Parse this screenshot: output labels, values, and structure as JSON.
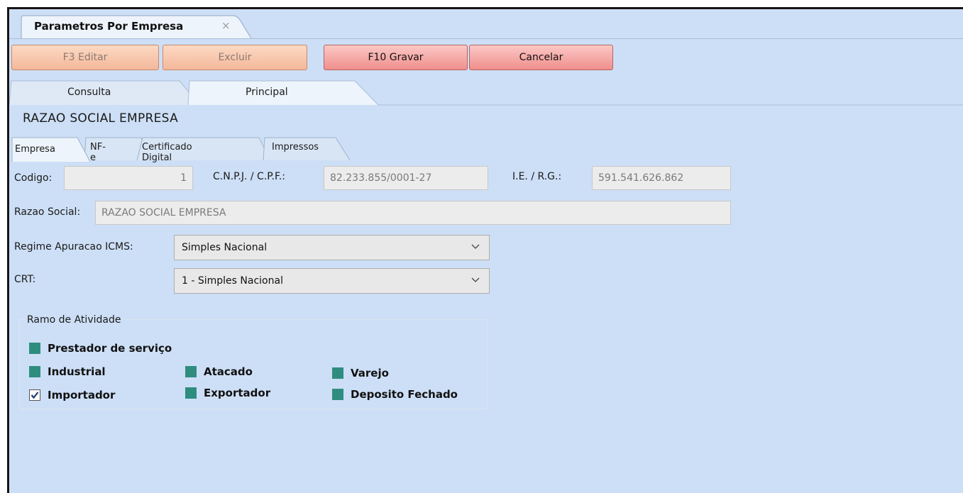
{
  "document_tab": {
    "title": "Parametros Por Empresa",
    "close_glyph": "×"
  },
  "toolbar": {
    "edit_label": "F3 Editar",
    "delete_label": "Excluir",
    "save_label": "F10 Gravar",
    "cancel_label": "Cancelar"
  },
  "main_tabs": [
    {
      "label": "Consulta",
      "selected": false
    },
    {
      "label": "Principal",
      "selected": true
    }
  ],
  "section_title": "RAZAO SOCIAL EMPRESA",
  "sub_tabs": [
    {
      "label": "Empresa",
      "selected": true
    },
    {
      "label": "NF-e",
      "selected": false
    },
    {
      "label": "Certificado Digital",
      "selected": false
    },
    {
      "label": "Impressos",
      "selected": false
    }
  ],
  "form": {
    "codigo": {
      "label": "Codigo:",
      "value": "1"
    },
    "cnpj": {
      "label": "C.N.P.J. / C.P.F.:",
      "value": "82.233.855/0001-27"
    },
    "ie": {
      "label": "I.E. / R.G.:",
      "value": "591.541.626.862"
    },
    "razao_social": {
      "label": "Razao Social:",
      "value": "RAZAO SOCIAL EMPRESA"
    },
    "regime": {
      "label": "Regime Apuracao ICMS:",
      "value": "Simples Nacional"
    },
    "crt": {
      "label": "CRT:",
      "value": "1 - Simples Nacional"
    }
  },
  "ramo": {
    "title": "Ramo de Atividade",
    "items": [
      {
        "label": "Prestador de serviço",
        "checked": false
      },
      {
        "label": "Industrial",
        "checked": false
      },
      {
        "label": "Atacado",
        "checked": false
      },
      {
        "label": "Varejo",
        "checked": false
      },
      {
        "label": "Importador",
        "checked": true
      },
      {
        "label": "Exportador",
        "checked": false
      },
      {
        "label": "Deposito Fechado",
        "checked": false
      }
    ]
  },
  "colors": {
    "background": "#cddff6",
    "disabled_button": "#f6c3a8",
    "active_button": "#f4a3a0",
    "checkbox_fill": "#2f8d80"
  }
}
